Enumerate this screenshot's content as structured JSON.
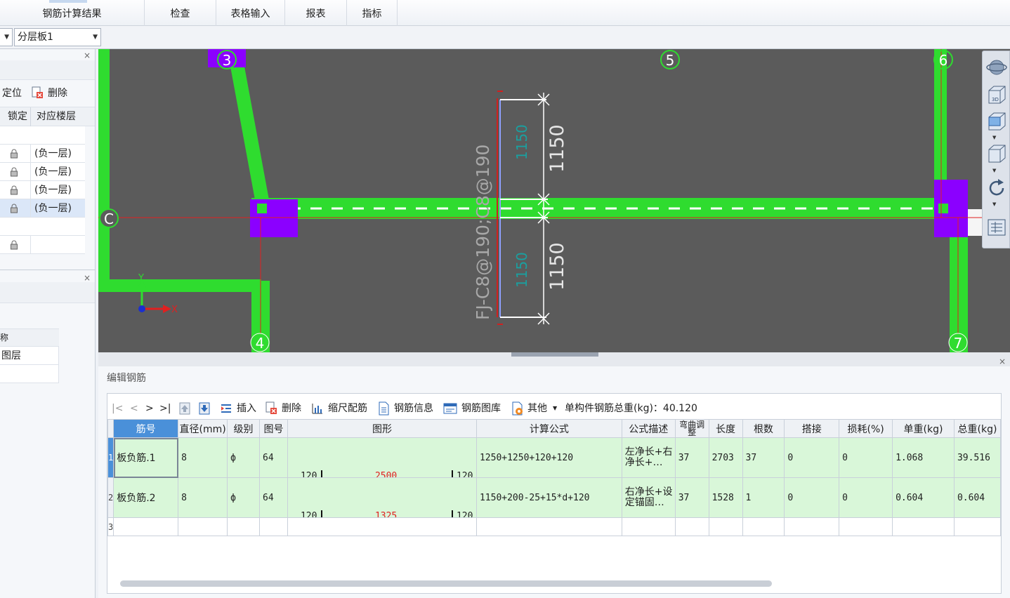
{
  "menubar": {
    "tabs": [
      {
        "label": "钢筋计算结果"
      },
      {
        "label": "检查"
      },
      {
        "label": "表格输入"
      },
      {
        "label": "报表"
      },
      {
        "label": "指标"
      }
    ]
  },
  "toolbar2": {
    "layer_combo": "分层板1"
  },
  "left_panel": {
    "locate_label": "定位",
    "delete_label": "删除",
    "col_lock": "锁定",
    "col_floor": "对应楼层",
    "rows": [
      "(负一层)",
      "(负一层)",
      "(负一层)",
      "(负一层)"
    ],
    "lower_header_fragment": "称",
    "lower_row_label": "图层"
  },
  "viewport": {
    "axis_labels": [
      "3",
      "5",
      "6",
      "C",
      "4",
      "7"
    ],
    "dim_labels": [
      "1150",
      "1150"
    ],
    "rebar_text": "FJ-C8@190;C8@190",
    "small_dim_labels": [
      "1150",
      "1150"
    ],
    "ucs_x": "X",
    "ucs_y": "Y"
  },
  "bottom_panel": {
    "title": "编辑钢筋",
    "toolbar": {
      "nav_first": "|<",
      "nav_prev": "<",
      "nav_next": ">",
      "nav_last": ">|",
      "insert": "插入",
      "delete": "删除",
      "scale_rebar": "缩尺配筋",
      "rebar_info": "钢筋信息",
      "rebar_library": "钢筋图库",
      "other": "其他",
      "total_weight_label": "单构件钢筋总重(kg)：40.120"
    },
    "columns": [
      "筋号",
      "直径(mm)",
      "级别",
      "图号",
      "图形",
      "计算公式",
      "公式描述",
      "弯曲调整",
      "长度",
      "根数",
      "搭接",
      "损耗(%)",
      "单重(kg)",
      "总重(kg)"
    ],
    "rows": [
      {
        "rn": "1",
        "name": "板负筋.1",
        "dia": "8",
        "grade": "ф",
        "fig": "64",
        "left": "120",
        "mid": "2500",
        "right": "120",
        "formula": "1250+1250+120+120",
        "desc": "左净长+右净长+…",
        "bend": "37",
        "length": "2703",
        "count": "37",
        "lap": "0",
        "loss": "0",
        "unit_w": "1.068",
        "total_w": "39.516"
      },
      {
        "rn": "2",
        "name": "板负筋.2",
        "dia": "8",
        "grade": "ф",
        "fig": "64",
        "left": "120",
        "mid": "1325",
        "right": "120",
        "formula": "1150+200-25+15*d+120",
        "desc": "右净长+设定锚固…",
        "bend": "37",
        "length": "1528",
        "count": "1",
        "lap": "0",
        "loss": "0",
        "unit_w": "0.604",
        "total_w": "0.604"
      }
    ],
    "empty_row_rn": "3"
  },
  "colors": {
    "accent_header": "#4a90d9",
    "row_green": "#d9f7d9",
    "beam_green": "#2fdc2f",
    "column_purple": "#8b00ff",
    "viewport_bg": "#5b5b5b"
  }
}
